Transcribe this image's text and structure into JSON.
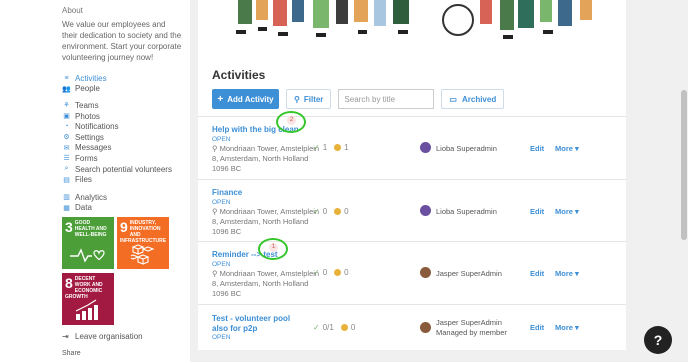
{
  "sidebar": {
    "about_title": "About",
    "about_text": "We value our employees and their dedication to society and the environment. Start your corporate volunteering journey now!",
    "nav_primary": [
      {
        "label": "Activities",
        "icon": "list-icon",
        "glyph": "≡"
      },
      {
        "label": "People",
        "icon": "people-icon",
        "glyph": "👥"
      }
    ],
    "nav_secondary": [
      {
        "label": "Teams",
        "icon": "teams-icon",
        "glyph": "⚘"
      },
      {
        "label": "Photos",
        "icon": "photo-icon",
        "glyph": "▣"
      },
      {
        "label": "Notifications",
        "icon": "bell-icon",
        "glyph": "◔"
      },
      {
        "label": "Settings",
        "icon": "gear-icon",
        "glyph": "⚙"
      },
      {
        "label": "Messages",
        "icon": "message-icon",
        "glyph": "✉"
      },
      {
        "label": "Forms",
        "icon": "form-icon",
        "glyph": "☰"
      },
      {
        "label": "Search potential volunteers",
        "icon": "search-icon",
        "glyph": "⌕"
      },
      {
        "label": "Files",
        "icon": "file-icon",
        "glyph": "▤"
      }
    ],
    "nav_tertiary": [
      {
        "label": "Analytics",
        "icon": "analytics-icon",
        "glyph": "▥"
      },
      {
        "label": "Data",
        "icon": "database-icon",
        "glyph": "▦"
      }
    ],
    "sdgs": [
      {
        "number": "3",
        "title": "GOOD HEALTH AND WELL-BEING",
        "color": "#4c9f38"
      },
      {
        "number": "9",
        "title": "INDUSTRY, INNOVATION AND INFRASTRUCTURE",
        "color": "#f36d25"
      },
      {
        "number": "8",
        "title": "DECENT WORK AND ECONOMIC GROWTH",
        "color": "#a21942"
      }
    ],
    "leave_label": "Leave organisation",
    "share_label": "Share"
  },
  "main": {
    "title": "Activities",
    "add_activity_label": "Add Activity",
    "filter_label": "Filter",
    "search_placeholder": "Search by title",
    "archived_label": "Archived",
    "edit_label": "Edit",
    "more_label": "More",
    "activities": [
      {
        "title": "Help with the big clean",
        "status": "OPEN",
        "address": "Mondriaan Tower, Amstelplein 8, Amsterdam, North Holland 1096 BC",
        "participants": "1",
        "points": "1",
        "owner": "Lioba Superadmin",
        "owner_sub": "",
        "badge": "2"
      },
      {
        "title": "Finance",
        "status": "OPEN",
        "address": "Mondriaan Tower, Amstelplein 8, Amsterdam, North Holland 1096 BC",
        "participants": "0",
        "points": "0",
        "owner": "Lioba Superadmin",
        "owner_sub": "",
        "badge": ""
      },
      {
        "title": "Reminder --> test",
        "status": "OPEN",
        "address": "Mondriaan Tower, Amstelplein 8, Amsterdam, North Holland 1096 BC",
        "participants": "0",
        "points": "0",
        "owner": "Jasper SuperAdmin",
        "owner_sub": "",
        "badge": "1"
      },
      {
        "title": "Test - volunteer pool also for p2p",
        "status": "OPEN",
        "address": "",
        "participants": "0/1",
        "points": "0",
        "owner": "Jasper SuperAdmin",
        "owner_sub": "Managed by member",
        "badge": ""
      }
    ]
  },
  "help_label": "?",
  "colors": {
    "accent": "#3d8fd6",
    "highlight_circle": "#35c62b"
  }
}
